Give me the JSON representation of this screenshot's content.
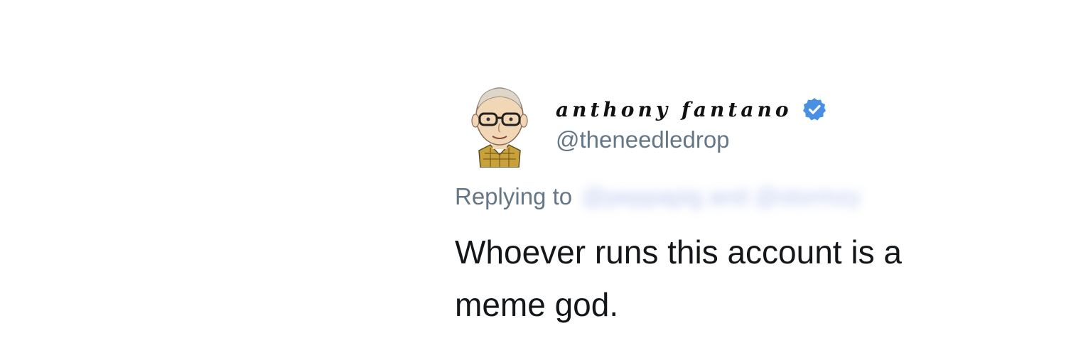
{
  "tweet": {
    "display_name": "anthony fantano",
    "handle": "@theneedledrop",
    "replying_to_label": "Replying to",
    "replying_to_targets": "@peppapig and @stormzy",
    "text": "Whoever runs this account is a meme god."
  },
  "icons": {
    "avatar": "cartoon-avatar",
    "verified": "verified-badge-icon"
  },
  "colors": {
    "verified_blue": "#4a90e2",
    "secondary_text": "#657786",
    "primary_text": "#14171a"
  }
}
